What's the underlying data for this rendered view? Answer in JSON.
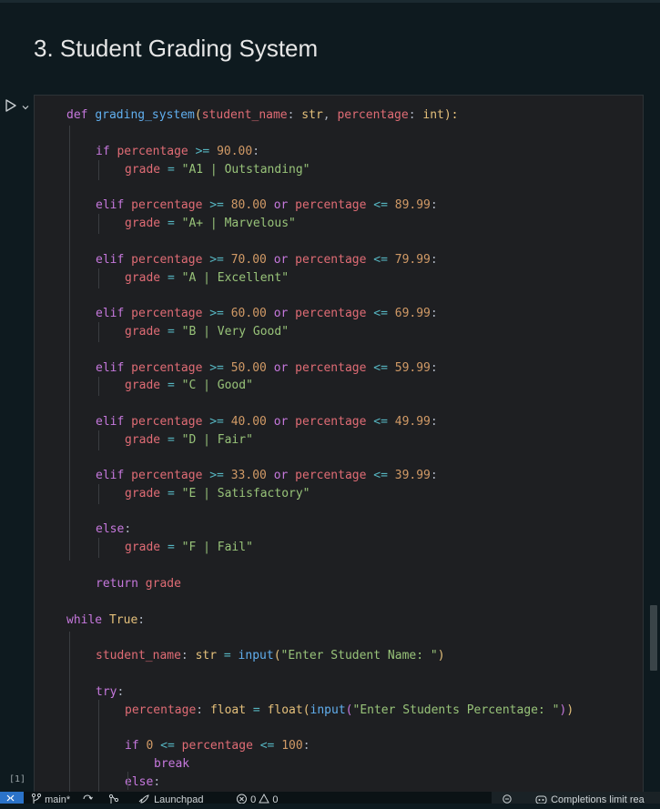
{
  "markdown": {
    "title": "3. Student Grading System"
  },
  "cell": {
    "execution_count": "[1]",
    "lines": [
      [
        [
          "kw",
          "def "
        ],
        [
          "fn",
          "grading_system"
        ],
        [
          "br1",
          "("
        ],
        [
          "param",
          "student_name"
        ],
        [
          "punc",
          ": "
        ],
        [
          "ty",
          "str"
        ],
        [
          "punc",
          ", "
        ],
        [
          "param",
          "percentage"
        ],
        [
          "punc",
          ": "
        ],
        [
          "ty",
          "int"
        ],
        [
          "br1",
          "):"
        ]
      ],
      [],
      [
        [
          "kw",
          "if "
        ],
        [
          "var",
          "percentage "
        ],
        [
          "op",
          ">= "
        ],
        [
          "num",
          "90.00"
        ],
        [
          "punc",
          ":"
        ]
      ],
      [
        [
          "var",
          "grade "
        ],
        [
          "op",
          "= "
        ],
        [
          "str",
          "\"A1 | Outstanding\""
        ]
      ],
      [],
      [
        [
          "kw",
          "elif "
        ],
        [
          "var",
          "percentage "
        ],
        [
          "op",
          ">= "
        ],
        [
          "num",
          "80.00 "
        ],
        [
          "kw",
          "or "
        ],
        [
          "var",
          "percentage "
        ],
        [
          "op",
          "<= "
        ],
        [
          "num",
          "89.99"
        ],
        [
          "punc",
          ":"
        ]
      ],
      [
        [
          "var",
          "grade "
        ],
        [
          "op",
          "= "
        ],
        [
          "str",
          "\"A+ | Marvelous\""
        ]
      ],
      [],
      [
        [
          "kw",
          "elif "
        ],
        [
          "var",
          "percentage "
        ],
        [
          "op",
          ">= "
        ],
        [
          "num",
          "70.00 "
        ],
        [
          "kw",
          "or "
        ],
        [
          "var",
          "percentage "
        ],
        [
          "op",
          "<= "
        ],
        [
          "num",
          "79.99"
        ],
        [
          "punc",
          ":"
        ]
      ],
      [
        [
          "var",
          "grade "
        ],
        [
          "op",
          "= "
        ],
        [
          "str",
          "\"A | Excellent\""
        ]
      ],
      [],
      [
        [
          "kw",
          "elif "
        ],
        [
          "var",
          "percentage "
        ],
        [
          "op",
          ">= "
        ],
        [
          "num",
          "60.00 "
        ],
        [
          "kw",
          "or "
        ],
        [
          "var",
          "percentage "
        ],
        [
          "op",
          "<= "
        ],
        [
          "num",
          "69.99"
        ],
        [
          "punc",
          ":"
        ]
      ],
      [
        [
          "var",
          "grade "
        ],
        [
          "op",
          "= "
        ],
        [
          "str",
          "\"B | Very Good\""
        ]
      ],
      [],
      [
        [
          "kw",
          "elif "
        ],
        [
          "var",
          "percentage "
        ],
        [
          "op",
          ">= "
        ],
        [
          "num",
          "50.00 "
        ],
        [
          "kw",
          "or "
        ],
        [
          "var",
          "percentage "
        ],
        [
          "op",
          "<= "
        ],
        [
          "num",
          "59.99"
        ],
        [
          "punc",
          ":"
        ]
      ],
      [
        [
          "var",
          "grade "
        ],
        [
          "op",
          "= "
        ],
        [
          "str",
          "\"C | Good\""
        ]
      ],
      [],
      [
        [
          "kw",
          "elif "
        ],
        [
          "var",
          "percentage "
        ],
        [
          "op",
          ">= "
        ],
        [
          "num",
          "40.00 "
        ],
        [
          "kw",
          "or "
        ],
        [
          "var",
          "percentage "
        ],
        [
          "op",
          "<= "
        ],
        [
          "num",
          "49.99"
        ],
        [
          "punc",
          ":"
        ]
      ],
      [
        [
          "var",
          "grade "
        ],
        [
          "op",
          "= "
        ],
        [
          "str",
          "\"D | Fair\""
        ]
      ],
      [],
      [
        [
          "kw",
          "elif "
        ],
        [
          "var",
          "percentage "
        ],
        [
          "op",
          ">= "
        ],
        [
          "num",
          "33.00 "
        ],
        [
          "kw",
          "or "
        ],
        [
          "var",
          "percentage "
        ],
        [
          "op",
          "<= "
        ],
        [
          "num",
          "39.99"
        ],
        [
          "punc",
          ":"
        ]
      ],
      [
        [
          "var",
          "grade "
        ],
        [
          "op",
          "= "
        ],
        [
          "str",
          "\"E | Satisfactory\""
        ]
      ],
      [],
      [
        [
          "kw",
          "else"
        ],
        [
          "punc",
          ":"
        ]
      ],
      [
        [
          "var",
          "grade "
        ],
        [
          "op",
          "= "
        ],
        [
          "str",
          "\"F | Fail\""
        ]
      ],
      [],
      [
        [
          "kw",
          "return "
        ],
        [
          "var",
          "grade"
        ]
      ],
      [],
      [
        [
          "kw",
          "while "
        ],
        [
          "ty",
          "True"
        ],
        [
          "punc",
          ":"
        ]
      ],
      [],
      [
        [
          "var",
          "student_name"
        ],
        [
          "punc",
          ": "
        ],
        [
          "ty",
          "str "
        ],
        [
          "op",
          "= "
        ],
        [
          "fn",
          "input"
        ],
        [
          "br1",
          "("
        ],
        [
          "str",
          "\"Enter Student Name: \""
        ],
        [
          "br1",
          ")"
        ]
      ],
      [],
      [
        [
          "kw",
          "try"
        ],
        [
          "punc",
          ":"
        ]
      ],
      [
        [
          "var",
          "percentage"
        ],
        [
          "punc",
          ": "
        ],
        [
          "ty",
          "float "
        ],
        [
          "op",
          "= "
        ],
        [
          "ty",
          "float"
        ],
        [
          "br1",
          "("
        ],
        [
          "fn",
          "input"
        ],
        [
          "br2",
          "("
        ],
        [
          "str",
          "\"Enter Students Percentage: \""
        ],
        [
          "br2",
          ")"
        ],
        [
          "br1",
          ")"
        ]
      ],
      [],
      [
        [
          "kw",
          "if "
        ],
        [
          "num",
          "0 "
        ],
        [
          "op",
          "<= "
        ],
        [
          "var",
          "percentage "
        ],
        [
          "op",
          "<= "
        ],
        [
          "num",
          "100"
        ],
        [
          "punc",
          ":"
        ]
      ],
      [
        [
          "kw",
          "break"
        ]
      ],
      [
        [
          "kw",
          "else"
        ],
        [
          "punc",
          ":"
        ]
      ]
    ]
  },
  "statusbar": {
    "remote_icon": "remote-icon",
    "branch": "main*",
    "launchpad": "Launchpad",
    "problems": "0",
    "warnings": "0",
    "completions": "Completions limit rea"
  }
}
